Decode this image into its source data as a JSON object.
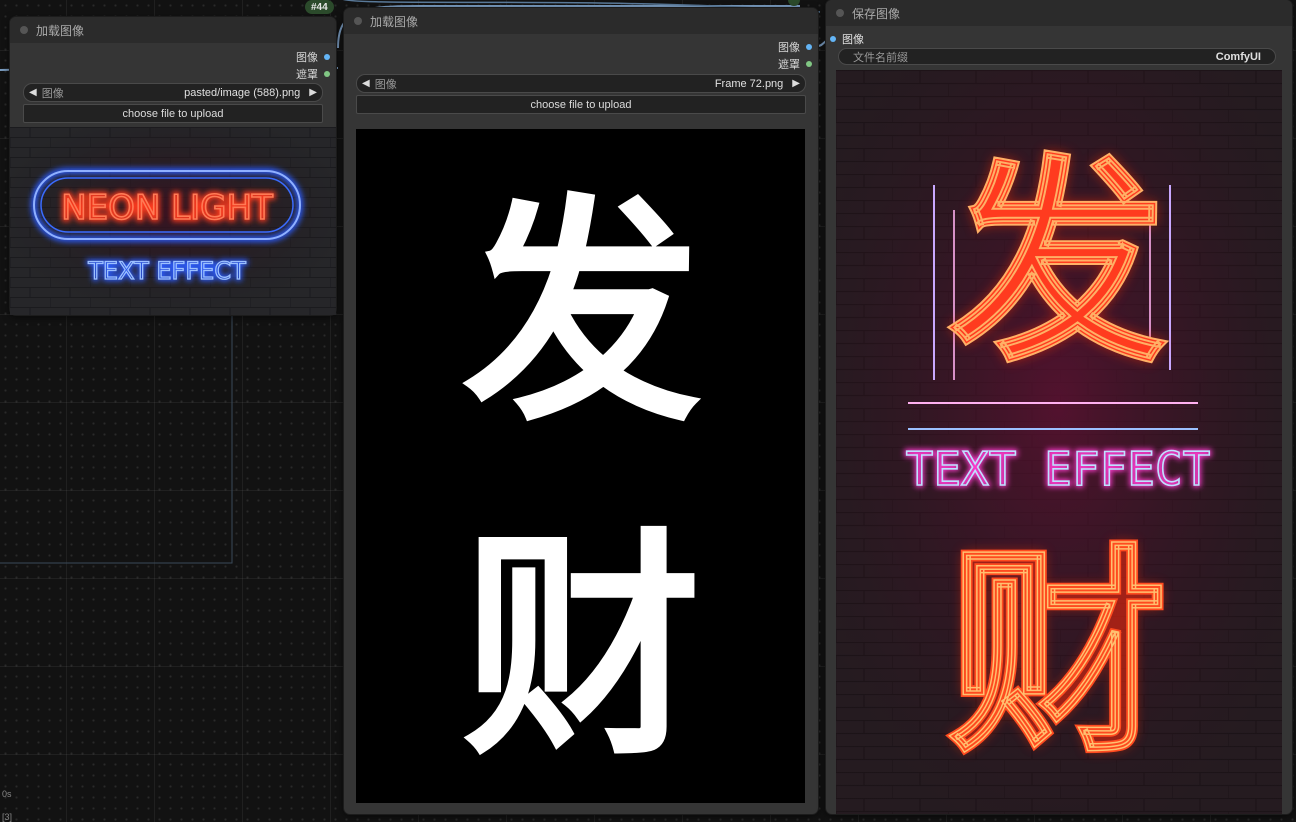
{
  "node_load_1": {
    "title": "加载图像",
    "outputs": [
      "图像",
      "遮罩"
    ],
    "widget_label": "图像",
    "filename": "pasted/image (588).png",
    "upload_button": "choose file to upload",
    "preview": {
      "line1": "NEON LIGHT",
      "line2": "TEXT EFFECT"
    }
  },
  "node_load_2": {
    "badge": "#44",
    "title": "加载图像",
    "outputs": [
      "图像",
      "遮罩"
    ],
    "widget_label": "图像",
    "filename": "Frame 72.png",
    "upload_button": "choose file to upload",
    "preview": {
      "char1": "发",
      "char2": "财"
    }
  },
  "node_save": {
    "title": "保存图像",
    "input_label": "图像",
    "field_label": "文件名前缀",
    "field_value": "ComfyUI",
    "preview": {
      "char1": "发",
      "char2": "财",
      "line": "TEXT EFFECT"
    }
  },
  "canvas": {
    "corner_text_1": "0s",
    "corner_text_2": "[3]"
  },
  "colors": {
    "slot_image": "#64b5f6",
    "slot_mask": "#81c784",
    "neon_red": "#ff3b1f",
    "neon_blue": "#2a6bff",
    "neon_pink": "#ff3ad0",
    "neon_purple": "#7a3cff"
  }
}
